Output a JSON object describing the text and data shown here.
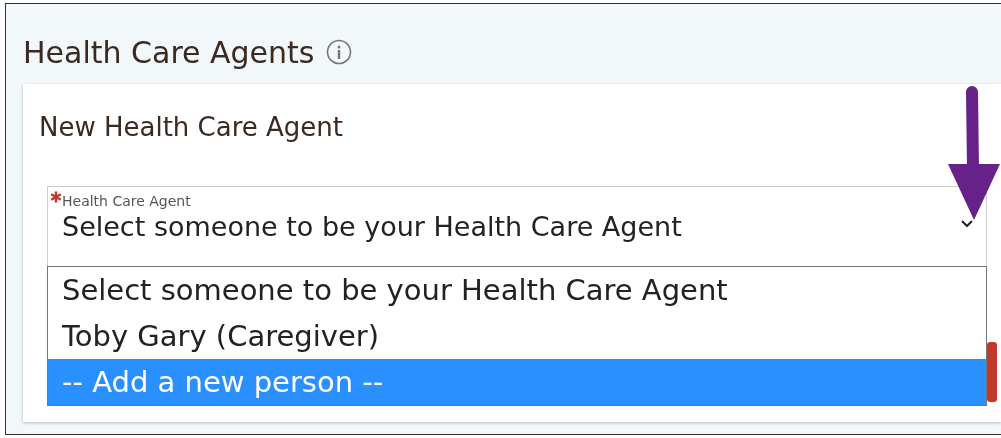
{
  "section": {
    "title": "Health Care Agents"
  },
  "card": {
    "title": "New Health Care Agent"
  },
  "field": {
    "label": "Health Care Agent",
    "required": true,
    "value": "Select someone to be your Health Care Agent",
    "expanded": true,
    "options": [
      {
        "label": "Select someone to be your Health Care Agent",
        "highlighted": false
      },
      {
        "label": "Toby Gary (Caregiver)",
        "highlighted": false
      },
      {
        "label": "-- Add a new person --",
        "highlighted": true
      }
    ]
  }
}
